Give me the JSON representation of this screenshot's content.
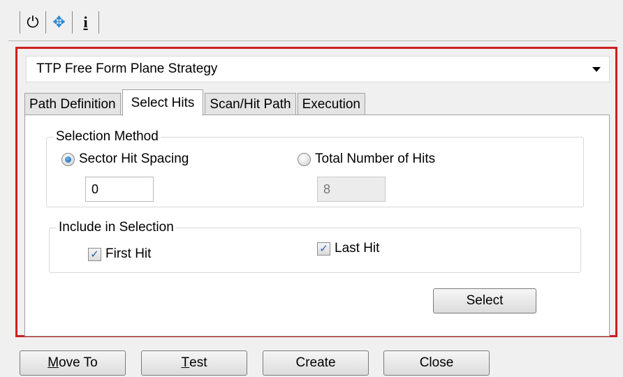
{
  "icon_tabs": [
    {
      "icon": "power-icon",
      "glyph": "⏻",
      "active": false
    },
    {
      "icon": "move-arrows-icon",
      "glyph": "✥",
      "active": true
    },
    {
      "icon": "info-icon",
      "glyph": "i",
      "active": false
    }
  ],
  "strategy": {
    "selected": "TTP Free Form Plane Strategy"
  },
  "tabs": [
    {
      "label": "Path Definition",
      "active": false
    },
    {
      "label": "Select Hits",
      "active": true
    },
    {
      "label": "Scan/Hit Path",
      "active": false
    },
    {
      "label": "Execution",
      "active": false
    }
  ],
  "selection_method": {
    "legend": "Selection Method",
    "sector_hit_spacing": {
      "label": "Sector Hit Spacing",
      "checked": true,
      "value": "0"
    },
    "total_number_of_hits": {
      "label": "Total Number of Hits",
      "checked": false,
      "value": "8"
    }
  },
  "include_in_selection": {
    "legend": "Include in Selection",
    "first_hit": {
      "label": "First Hit",
      "checked": true
    },
    "last_hit": {
      "label": "Last Hit",
      "checked": true
    }
  },
  "select_button": {
    "label": "Select"
  },
  "bottom_buttons": {
    "move_to": {
      "mnemonic": "M",
      "rest": "ove To"
    },
    "test": {
      "mnemonic": "T",
      "rest": "est"
    },
    "create": {
      "label": "Create"
    },
    "close": {
      "label": "Close"
    }
  },
  "colors": {
    "highlight_border": "#cc1f1f",
    "active_icon": "#2a86d6"
  }
}
